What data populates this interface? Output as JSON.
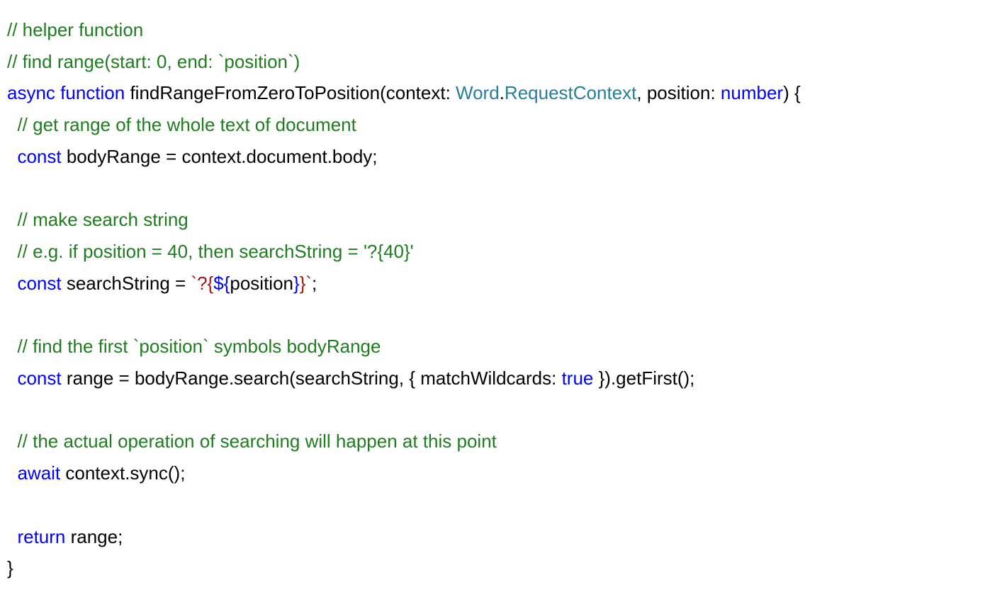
{
  "code": {
    "line1": {
      "comment": "// helper function"
    },
    "line2": {
      "comment": "// find range(start: 0, end: `position`)"
    },
    "line3": {
      "kw_async": "async",
      "kw_function": "function",
      "fn_name": " findRangeFromZeroToPosition",
      "paren_open": "(",
      "param1_name": "context",
      "colon1": ": ",
      "type_word": "Word",
      "dot": ".",
      "type_reqctx": "RequestContext",
      "comma": ", ",
      "param2_name": "position",
      "colon2": ": ",
      "type_number": "number",
      "paren_close_brace": ") {"
    },
    "line4": {
      "comment": "  // get range of the whole text of document"
    },
    "line5": {
      "indent": "  ",
      "kw_const": "const",
      "rest": " bodyRange = context.document.body;"
    },
    "line6": {
      "blank": ""
    },
    "line7": {
      "comment": "  // make search string"
    },
    "line8": {
      "comment": "  // e.g. if position = 40, then searchString = '?{40}'"
    },
    "line9": {
      "indent": "  ",
      "kw_const": "const",
      "mid": " searchString = ",
      "str_open": "`?{",
      "interp_open": "${",
      "interp_expr": "position",
      "interp_close": "}",
      "str_close": "}`",
      "semi": ";"
    },
    "line10": {
      "blank": ""
    },
    "line11": {
      "comment": "  // find the first `position` symbols bodyRange"
    },
    "line12": {
      "indent": "  ",
      "kw_const": "const",
      "mid": " range = bodyRange.search(searchString, { matchWildcards: ",
      "kw_true": "true",
      "tail": " }).getFirst();"
    },
    "line13": {
      "blank": ""
    },
    "line14": {
      "comment": "  // the actual operation of searching will happen at this point"
    },
    "line15": {
      "indent": "  ",
      "kw_await": "await",
      "rest": " context.sync();"
    },
    "line16": {
      "blank": ""
    },
    "line17": {
      "indent": "  ",
      "kw_return": "return",
      "rest": " range;"
    },
    "line18": {
      "brace": "}"
    }
  }
}
